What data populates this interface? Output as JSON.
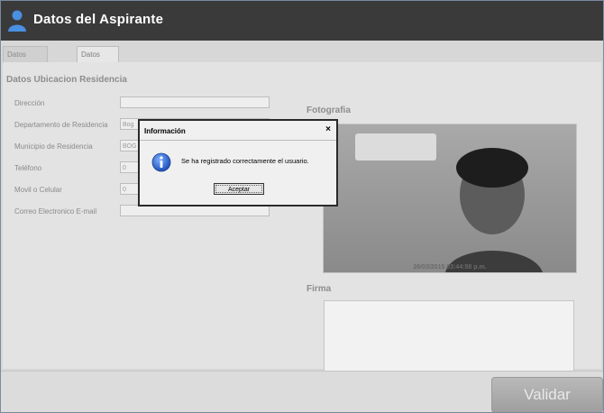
{
  "app": {
    "title": "Datos del Aspirante"
  },
  "tabs": [
    {
      "label": "Datos Personales"
    },
    {
      "label": "Datos Generales"
    }
  ],
  "form": {
    "section_title": "Datos Ubicacion Residencia",
    "fields": [
      {
        "label": "Dirección",
        "value": ""
      },
      {
        "label": "Departamento de Residencia",
        "value": "Bog"
      },
      {
        "label": "Municipio de Residencia",
        "value": "BOG"
      },
      {
        "label": "Teléfono",
        "value": "0"
      },
      {
        "label": "Movil o Celular",
        "value": "0"
      },
      {
        "label": "Correo Electronico E-mail",
        "value": ""
      }
    ]
  },
  "photo": {
    "title": "Fotografia",
    "timestamp": "26/03/2015 03:44:58 p.m."
  },
  "signature": {
    "title": "Firma"
  },
  "footer": {
    "validate_label": "Validar"
  },
  "dialog": {
    "title": "Información",
    "close": "×",
    "message": "Se ha registrado correctamente el usuario.",
    "ok_label": "Aceptar",
    "icon": "info-icon"
  },
  "colors": {
    "titlebar": "#3a3a3a",
    "overlay": "#d7d7d7",
    "info_blue": "#2a63c8"
  }
}
